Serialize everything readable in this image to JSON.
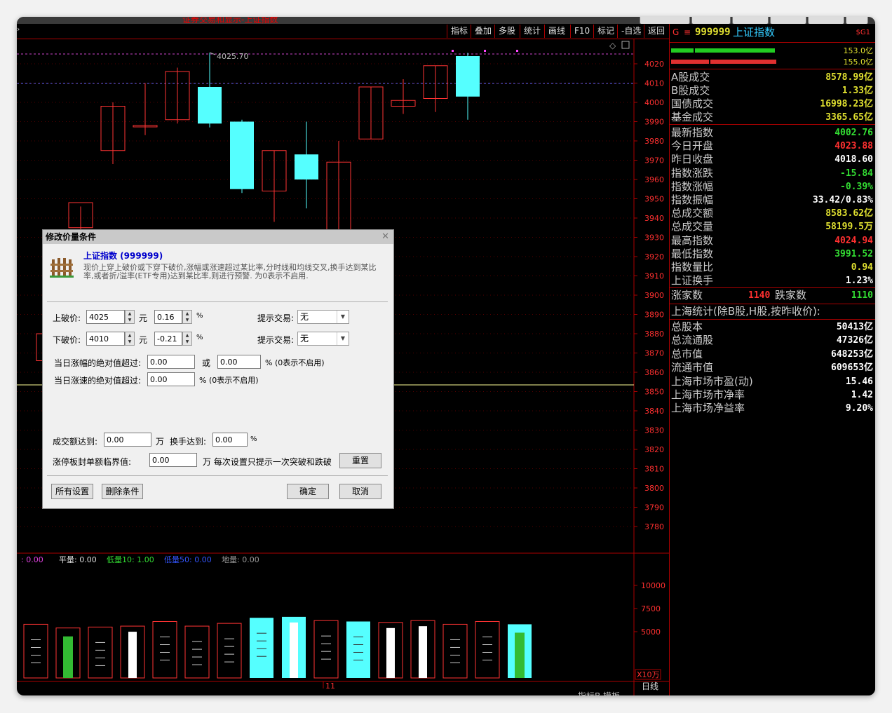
{
  "window_title": "证券交易和显示-上证指数",
  "toolbar": [
    "指标",
    "叠加",
    "多股",
    "统计",
    "画线",
    "F10",
    "标记",
    "-自选",
    "返回"
  ],
  "price_axis": [
    "4020",
    "4010",
    "4000",
    "3990",
    "3980",
    "3970",
    "3960",
    "3950",
    "3940",
    "3930",
    "3920",
    "3910",
    "3900",
    "3890",
    "3880",
    "3870",
    "3860",
    "3850",
    "3840",
    "3830",
    "3820",
    "3810",
    "3800",
    "3790",
    "3780"
  ],
  "high_label": "4025.70",
  "volume_legend": [
    {
      "text": ": 0.00",
      "color": "#e040e0"
    },
    {
      "text": "平量: 0.00",
      "color": "#dddddd"
    },
    {
      "text": "低量10: 1.00",
      "color": "#33dd33"
    },
    {
      "text": "低量50: 0.00",
      "color": "#3355ff"
    },
    {
      "text": "地量: 0.00",
      "color": "#999999"
    }
  ],
  "volume_axis": [
    "10000",
    "7500",
    "5000"
  ],
  "volume_unit": "X10万",
  "date_marker": "11",
  "period_label": "日线",
  "bottom_tabs": [
    "指标B",
    "模板"
  ],
  "chart_data": {
    "type": "candlestick",
    "high_annotation": 4025.7,
    "candles": [
      {
        "open": 3866,
        "high": 3878,
        "low": 3864,
        "close": 3880,
        "color": "red"
      },
      {
        "open": 3935,
        "high": 3946,
        "low": 3920,
        "close": 3948,
        "color": "red"
      },
      {
        "open": 3975,
        "high": 4000,
        "low": 3968,
        "close": 3998,
        "color": "red"
      },
      {
        "open": 3988,
        "high": 4010,
        "low": 3983,
        "close": 3988,
        "color": "red"
      },
      {
        "open": 3991,
        "high": 4018,
        "low": 3989,
        "close": 4016,
        "color": "red"
      },
      {
        "open": 4008,
        "high": 4025.7,
        "low": 3987,
        "close": 3989,
        "color": "cyan"
      },
      {
        "open": 3990,
        "high": 3991,
        "low": 3953,
        "close": 3955,
        "color": "cyan"
      },
      {
        "open": 3954,
        "high": 3975,
        "low": 3938,
        "close": 3975,
        "color": "red"
      },
      {
        "open": 3973,
        "high": 3990,
        "low": 3945,
        "close": 3960,
        "color": "cyan"
      },
      {
        "open": 3921,
        "high": 3980,
        "low": 3918,
        "close": 3969,
        "color": "red"
      },
      {
        "open": 3981,
        "high": 4008,
        "low": 3981,
        "close": 4008,
        "color": "red"
      },
      {
        "open": 3998,
        "high": 4012,
        "low": 3994,
        "close": 4001,
        "color": "red"
      },
      {
        "open": 4002,
        "high": 4019,
        "low": 3995,
        "close": 4019,
        "color": "red"
      },
      {
        "open": 4024,
        "high": 4025.7,
        "low": 3991,
        "close": 4003,
        "color": "cyan"
      }
    ],
    "volume": [
      {
        "value": 5800,
        "color": "red",
        "inner": "dash"
      },
      {
        "value": 5400,
        "color": "red",
        "inner": "green"
      },
      {
        "value": 5500,
        "color": "red",
        "inner": "dash"
      },
      {
        "value": 5600,
        "color": "red",
        "inner": "white"
      },
      {
        "value": 6100,
        "color": "red",
        "inner": "dash"
      },
      {
        "value": 5600,
        "color": "red",
        "inner": "dash"
      },
      {
        "value": 5900,
        "color": "red",
        "inner": "dash"
      },
      {
        "value": 6500,
        "color": "cyan",
        "inner": "dash"
      },
      {
        "value": 6600,
        "color": "cyan",
        "inner": "white"
      },
      {
        "value": 6200,
        "color": "red",
        "inner": "dash"
      },
      {
        "value": 6100,
        "color": "cyan",
        "inner": "dash"
      },
      {
        "value": 6000,
        "color": "red",
        "inner": "white"
      },
      {
        "value": 6200,
        "color": "red",
        "inner": "white"
      },
      {
        "value": 5800,
        "color": "red",
        "inner": "dash"
      },
      {
        "value": 6100,
        "color": "red",
        "inner": "dash"
      },
      {
        "value": 5800,
        "color": "cyan",
        "inner": "green"
      }
    ]
  },
  "right_panel": {
    "header": {
      "g": "G",
      "code": "999999",
      "name": "上证指数",
      "tag": "$G1"
    },
    "bars": [
      {
        "val": "153.0亿",
        "color": "#22cc22"
      },
      {
        "val": "155.0亿",
        "color": "#e03030"
      }
    ],
    "rows1": [
      {
        "label": "A股成交",
        "value": "8578.99亿",
        "color": "#e0e030"
      },
      {
        "label": "B股成交",
        "value": "1.33亿",
        "color": "#e0e030"
      },
      {
        "label": "国债成交",
        "value": "16998.23亿",
        "color": "#e0e030"
      },
      {
        "label": "基金成交",
        "value": "3365.65亿",
        "color": "#e0e030"
      }
    ],
    "rows2": [
      {
        "label": "最新指数",
        "value": "4002.76",
        "color": "#33dd33"
      },
      {
        "label": "今日开盘",
        "value": "4023.88",
        "color": "#ff3030"
      },
      {
        "label": "昨日收盘",
        "value": "4018.60",
        "color": "#ffffff"
      },
      {
        "label": "指数涨跌",
        "value": "-15.84",
        "color": "#33dd33"
      },
      {
        "label": "指数涨幅",
        "value": "-0.39%",
        "color": "#33dd33"
      },
      {
        "label": "指数振幅",
        "value": "33.42/0.83%",
        "color": "#ffffff"
      },
      {
        "label": "总成交额",
        "value": "8583.62亿",
        "color": "#e0e030"
      },
      {
        "label": "总成交量",
        "value": "58199.5万",
        "color": "#e0e030"
      },
      {
        "label": "最高指数",
        "value": "4024.94",
        "color": "#ff3030"
      },
      {
        "label": "最低指数",
        "value": "3991.52",
        "color": "#33dd33"
      },
      {
        "label": "指数量比",
        "value": "0.94",
        "color": "#e0e030"
      },
      {
        "label": "上证换手",
        "value": "1.23%",
        "color": "#ffffff"
      }
    ],
    "updown": {
      "up_label": "涨家数",
      "up": "1140",
      "down_label": "跌家数",
      "down": "1110"
    },
    "stats_title": "上海统计(除B股,H股,按昨收价):",
    "rows3": [
      {
        "label": "总股本",
        "value": "50413亿",
        "color": "#ffffff"
      },
      {
        "label": "总流通股",
        "value": "47326亿",
        "color": "#ffffff"
      },
      {
        "label": "总市值",
        "value": "648253亿",
        "color": "#ffffff"
      },
      {
        "label": "流通市值",
        "value": "609653亿",
        "color": "#ffffff"
      },
      {
        "label": "上海市场市盈(动)",
        "value": "15.46",
        "color": "#ffffff"
      },
      {
        "label": "上海市场市净率",
        "value": "1.42",
        "color": "#ffffff"
      },
      {
        "label": "上海市场净益率",
        "value": "9.20%",
        "color": "#ffffff"
      }
    ]
  },
  "dialog": {
    "title": "修改价量条件",
    "stock": "上证指数 (999999)",
    "desc": "现价上穿上破价或下穿下破价,涨幅或涨速超过某比率,分时线和均线交叉,换手达到某比率,或者折/溢率(ETF专用)达到某比率,则进行预警. 为0表示不启用.",
    "upper_label": "上破价:",
    "upper_value": "4025",
    "yuan": "元",
    "upper_pct": "0.16",
    "pct": "%",
    "trade_label": "提示交易:",
    "trade_value": "无",
    "lower_label": "下破价:",
    "lower_value": "4010",
    "lower_pct": "-0.21",
    "amp_label": "当日涨幅的绝对值超过:",
    "amp_value1": "0.00",
    "or": "或",
    "amp_value2": "0.00",
    "amp_note": "% (0表示不启用)",
    "speed_label": "当日涨速的绝对值超过:",
    "speed_value": "0.00",
    "speed_note": "% (0表示不启用)",
    "turnover_label": "成交额达到:",
    "turnover_value": "0.00",
    "wan": "万",
    "hand_label": "换手达到:",
    "hand_value": "0.00",
    "limit_label": "涨停板封单额临界值:",
    "limit_value": "0.00",
    "limit_note": "万  每次设置只提示一次突破和跌破",
    "reset": "重置",
    "all_settings": "所有设置",
    "delete": "删除条件",
    "ok": "确定",
    "cancel": "取消"
  }
}
